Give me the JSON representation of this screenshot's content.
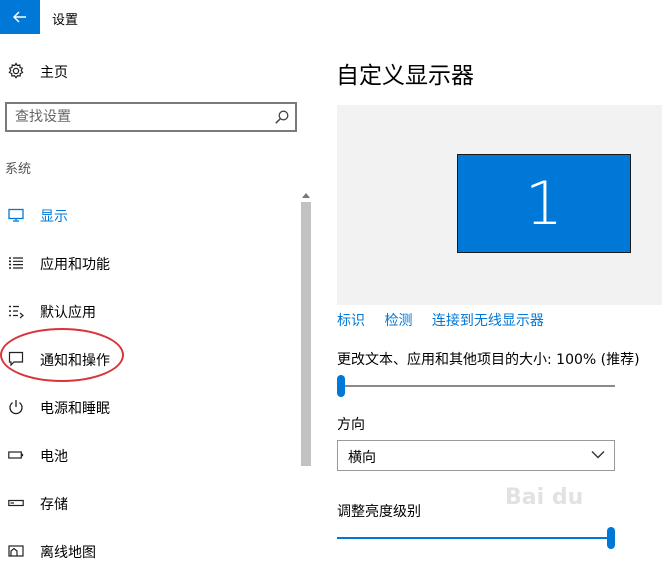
{
  "window": {
    "title": "设置"
  },
  "nav": {
    "home_label": "主页",
    "search_placeholder": "查找设置",
    "group_header": "系统",
    "items": [
      {
        "label": "显示",
        "icon": "display-icon",
        "active": true
      },
      {
        "label": "应用和功能",
        "icon": "apps-list-icon",
        "active": false
      },
      {
        "label": "默认应用",
        "icon": "default-apps-icon",
        "active": false
      },
      {
        "label": "通知和操作",
        "icon": "notification-icon",
        "active": false
      },
      {
        "label": "电源和睡眠",
        "icon": "power-icon",
        "active": false
      },
      {
        "label": "电池",
        "icon": "battery-icon",
        "active": false
      },
      {
        "label": "存储",
        "icon": "storage-icon",
        "active": false
      },
      {
        "label": "离线地图",
        "icon": "offline-maps-icon",
        "active": false
      }
    ]
  },
  "content": {
    "title": "自定义显示器",
    "monitor_number": "1",
    "links": {
      "identify": "标识",
      "detect": "检测",
      "wireless": "连接到无线显示器"
    },
    "scale": {
      "label": "更改文本、应用和其他项目的大小: 100% (推荐)",
      "value_fraction": 0.0
    },
    "orientation": {
      "label": "方向",
      "selected": "横向"
    },
    "brightness": {
      "label": "调整亮度级别",
      "value_fraction": 1.0
    }
  },
  "colors": {
    "accent": "#0078d7",
    "highlight_circle": "#d9343a",
    "preview_bg": "#f2f2f2"
  }
}
